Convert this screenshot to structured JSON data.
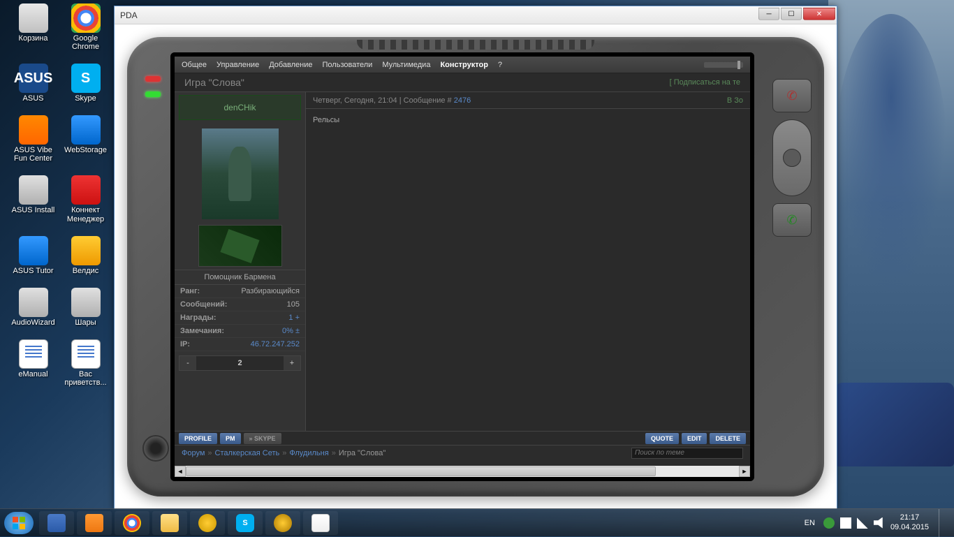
{
  "desktop": {
    "icons": [
      {
        "label": "Корзина",
        "cls": "ic-bin"
      },
      {
        "label": "Google Chrome",
        "cls": "ic-chrome"
      },
      {
        "label": "ASUS",
        "cls": "ic-asus",
        "glyph": "ASUS"
      },
      {
        "label": "Skype",
        "cls": "ic-skype",
        "glyph": "S"
      },
      {
        "label": "ASUS Vibe Fun Center",
        "cls": "ic-orange"
      },
      {
        "label": "WebStorage",
        "cls": "ic-blue"
      },
      {
        "label": "ASUS Install",
        "cls": "ic-generic"
      },
      {
        "label": "Коннект Менеджер",
        "cls": "ic-red"
      },
      {
        "label": "ASUS Tutor",
        "cls": "ic-blue"
      },
      {
        "label": "Велдис",
        "cls": "ic-gold"
      },
      {
        "label": "AudioWizard",
        "cls": "ic-generic"
      },
      {
        "label": "Шары",
        "cls": "ic-generic"
      },
      {
        "label": "eManual",
        "cls": "ic-doc"
      },
      {
        "label": "Вас приветств...",
        "cls": "ic-doc"
      }
    ]
  },
  "window": {
    "title": "PDA"
  },
  "forum": {
    "menu": [
      "Общее",
      "Управление",
      "Добавление",
      "Пользователи",
      "Мультимедиа",
      "Конструктор",
      "?"
    ],
    "active_menu": "Конструктор",
    "topic_title": "Игра \"Слова\"",
    "subscribe": "[ Подписаться на те",
    "post": {
      "username": "denCHik",
      "rank_title": "Помощник Бармена",
      "stats": [
        {
          "k": "Ранг:",
          "v": "Разбирающийся"
        },
        {
          "k": "Сообщений:",
          "v": "105"
        },
        {
          "k": "Награды:",
          "v": "1 +",
          "link": true
        },
        {
          "k": "Замечания:",
          "v": "0% ±",
          "link": true
        },
        {
          "k": "IP:",
          "v": "46.72.247.252",
          "link": true
        }
      ],
      "pager_num": "2",
      "meta_prefix": "Четверг, Сегодня, 21:04 | Сообщение # ",
      "meta_num": "2476",
      "status": "В Зо",
      "body": "Рельсы"
    },
    "actions_left": [
      {
        "t": "PROFILE",
        "cls": ""
      },
      {
        "t": "PM",
        "cls": ""
      },
      {
        "t": "» SKYPE",
        "cls": "g"
      }
    ],
    "actions_right": [
      {
        "t": "QUOTE",
        "cls": ""
      },
      {
        "t": "EDIT",
        "cls": ""
      },
      {
        "t": "DELETE",
        "cls": ""
      }
    ],
    "breadcrumb": [
      "Форум",
      "Сталкерская Сеть",
      "Флудильня"
    ],
    "breadcrumb_current": "Игра \"Слова\"",
    "search_placeholder": "Поиск по теме"
  },
  "taskbar": {
    "lang": "EN",
    "time": "21:17",
    "date": "09.04.2015"
  }
}
